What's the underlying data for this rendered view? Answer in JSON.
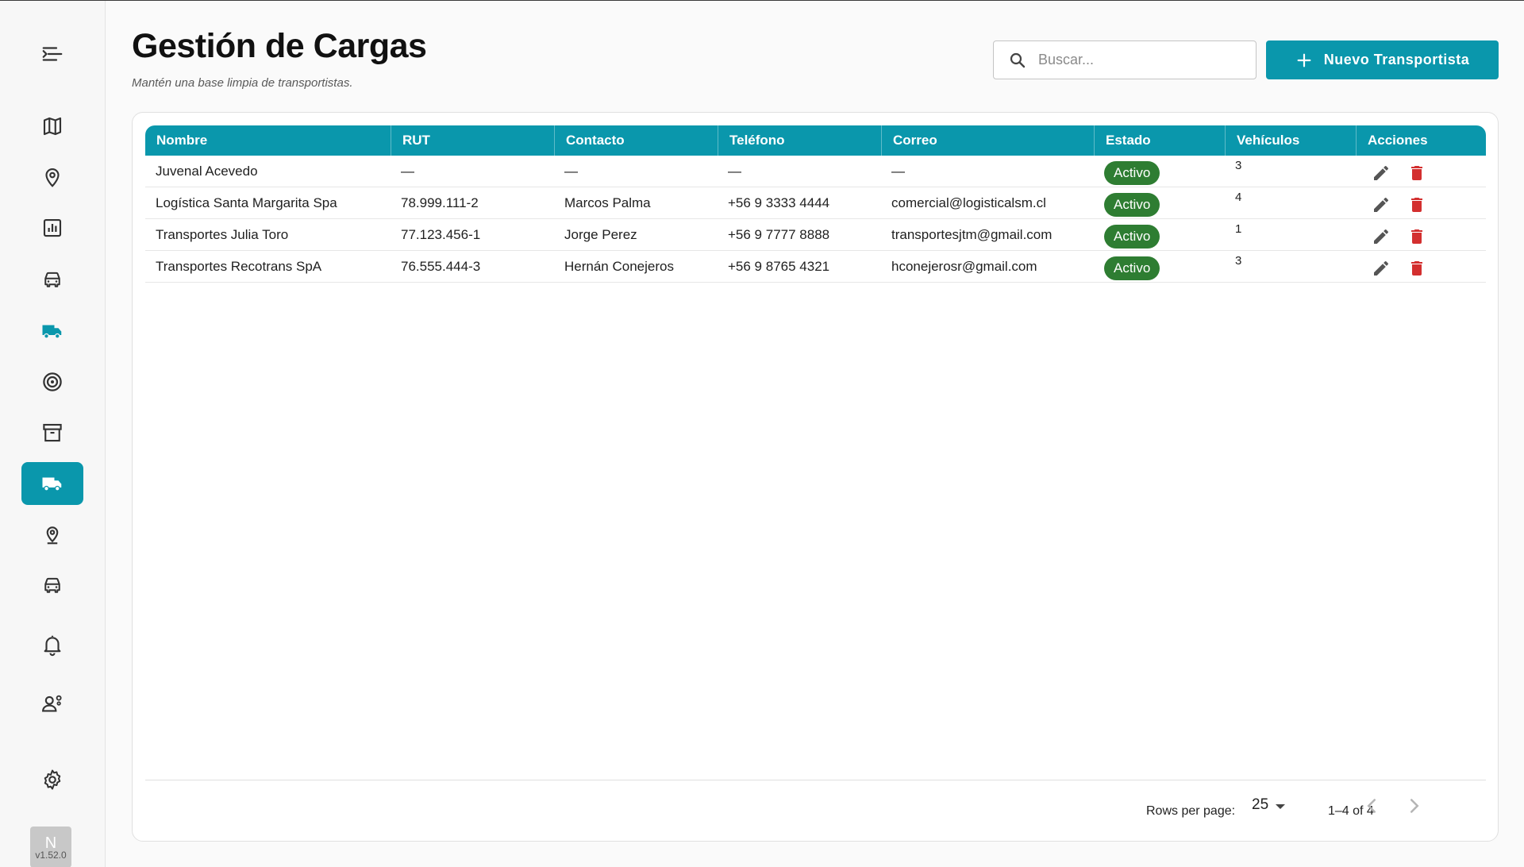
{
  "app": {
    "title": "Gestión de Cargas",
    "subtitle": "Mantén una base limpia de transportistas.",
    "version": "v1.52.0",
    "avatar_initial": "N"
  },
  "colors": {
    "accent": "#0a97ac",
    "status_active": "#2e7d32",
    "delete": "#d32f2f",
    "edit": "#555555"
  },
  "sidebar": {
    "items": [
      {
        "icon": "menu-collapse-icon",
        "active": false
      },
      {
        "icon": "map-icon",
        "active": false
      },
      {
        "icon": "location-pin-icon",
        "active": false
      },
      {
        "icon": "bar-chart-icon",
        "active": false
      },
      {
        "icon": "car-icon",
        "active": false
      },
      {
        "icon": "truck-icon",
        "active": false
      },
      {
        "icon": "target-icon",
        "active": false
      },
      {
        "icon": "archive-icon",
        "active": false
      },
      {
        "icon": "truck-icon",
        "active": true
      },
      {
        "icon": "location-pin-icon",
        "active": false
      },
      {
        "icon": "car-icon",
        "active": false
      },
      {
        "icon": "bell-icon",
        "active": false
      },
      {
        "icon": "user-settings-icon",
        "active": false
      },
      {
        "icon": "gear-icon",
        "active": false
      }
    ]
  },
  "search": {
    "placeholder": "Buscar...",
    "value": ""
  },
  "actions": {
    "new_label": "Nuevo Transportista"
  },
  "table": {
    "columns": [
      "Nombre",
      "RUT",
      "Contacto",
      "Teléfono",
      "Correo",
      "Estado",
      "Vehículos",
      "Acciones"
    ],
    "rows": [
      {
        "nombre": "Juvenal Acevedo",
        "rut": "—",
        "contacto": "—",
        "telefono": "—",
        "correo": "—",
        "estado": "Activo",
        "vehiculos": "3"
      },
      {
        "nombre": "Logística Santa Margarita Spa",
        "rut": "78.999.111-2",
        "contacto": "Marcos Palma",
        "telefono": "+56 9 3333 4444",
        "correo": "comercial@logisticalsm.cl",
        "estado": "Activo",
        "vehiculos": "4"
      },
      {
        "nombre": "Transportes Julia Toro",
        "rut": "77.123.456-1",
        "contacto": "Jorge Perez",
        "telefono": "+56 9 7777 8888",
        "correo": "transportesjtm@gmail.com",
        "estado": "Activo",
        "vehiculos": "1"
      },
      {
        "nombre": "Transportes Recotrans SpA",
        "rut": "76.555.444-3",
        "contacto": "Hernán Conejeros",
        "telefono": "+56 9 8765 4321",
        "correo": "hconejerosr@gmail.com",
        "estado": "Activo",
        "vehiculos": "3"
      }
    ]
  },
  "pagination": {
    "rows_per_page_label": "Rows per page:",
    "rows_per_page": "25",
    "range": "1–4 of 4"
  }
}
